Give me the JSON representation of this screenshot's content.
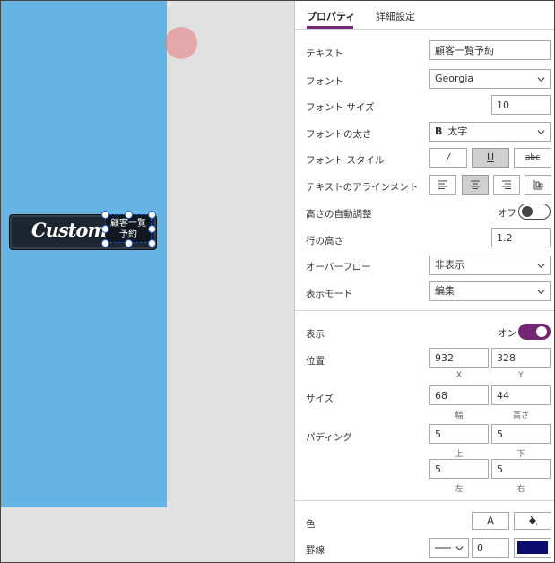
{
  "canvas": {
    "customer_label": "Customer",
    "selected_label_lines": [
      "顧客一覧",
      "予約"
    ]
  },
  "tabs": {
    "properties": "プロパティ",
    "advanced": "詳細設定"
  },
  "props": {
    "text_label": "テキスト",
    "text_value": "顧客一覧予約",
    "font_label": "フォント",
    "font_value": "Georgia",
    "font_size_label": "フォント サイズ",
    "font_size_value": "10",
    "font_weight_label": "フォントの太さ",
    "font_weight_glyph": "B",
    "font_weight_value": "太字",
    "font_style_label": "フォント スタイル",
    "font_style_italic": "/",
    "font_style_underline": "U",
    "font_style_strike": "abc",
    "align_label": "テキストのアラインメント",
    "autoheight_label": "高さの自動調整",
    "autoheight_state": "オフ",
    "line_height_label": "行の高さ",
    "line_height_value": "1.2",
    "overflow_label": "オーバーフロー",
    "overflow_value": "非表示",
    "display_mode_label": "表示モード",
    "display_mode_value": "編集",
    "visible_label": "表示",
    "visible_state": "オン",
    "position_label": "位置",
    "position_x": "932",
    "position_y": "328",
    "position_x_caption": "X",
    "position_y_caption": "Y",
    "size_label": "サイズ",
    "size_width": "68",
    "size_height": "44",
    "size_width_caption": "幅",
    "size_height_caption": "高さ",
    "padding_label": "パディング",
    "padding_top": "5",
    "padding_bottom": "5",
    "padding_left": "5",
    "padding_right": "5",
    "padding_top_caption": "上",
    "padding_bottom_caption": "下",
    "padding_left_caption": "左",
    "padding_right_caption": "右",
    "color_label": "色",
    "color_text_glyph": "A",
    "border_label": "罫線",
    "border_width_value": "0",
    "border_color": "#0b0e6e"
  },
  "colors": {
    "accent": "#742774",
    "screen": "#64b4e4",
    "canvas_bg": "#e1e1e1"
  }
}
